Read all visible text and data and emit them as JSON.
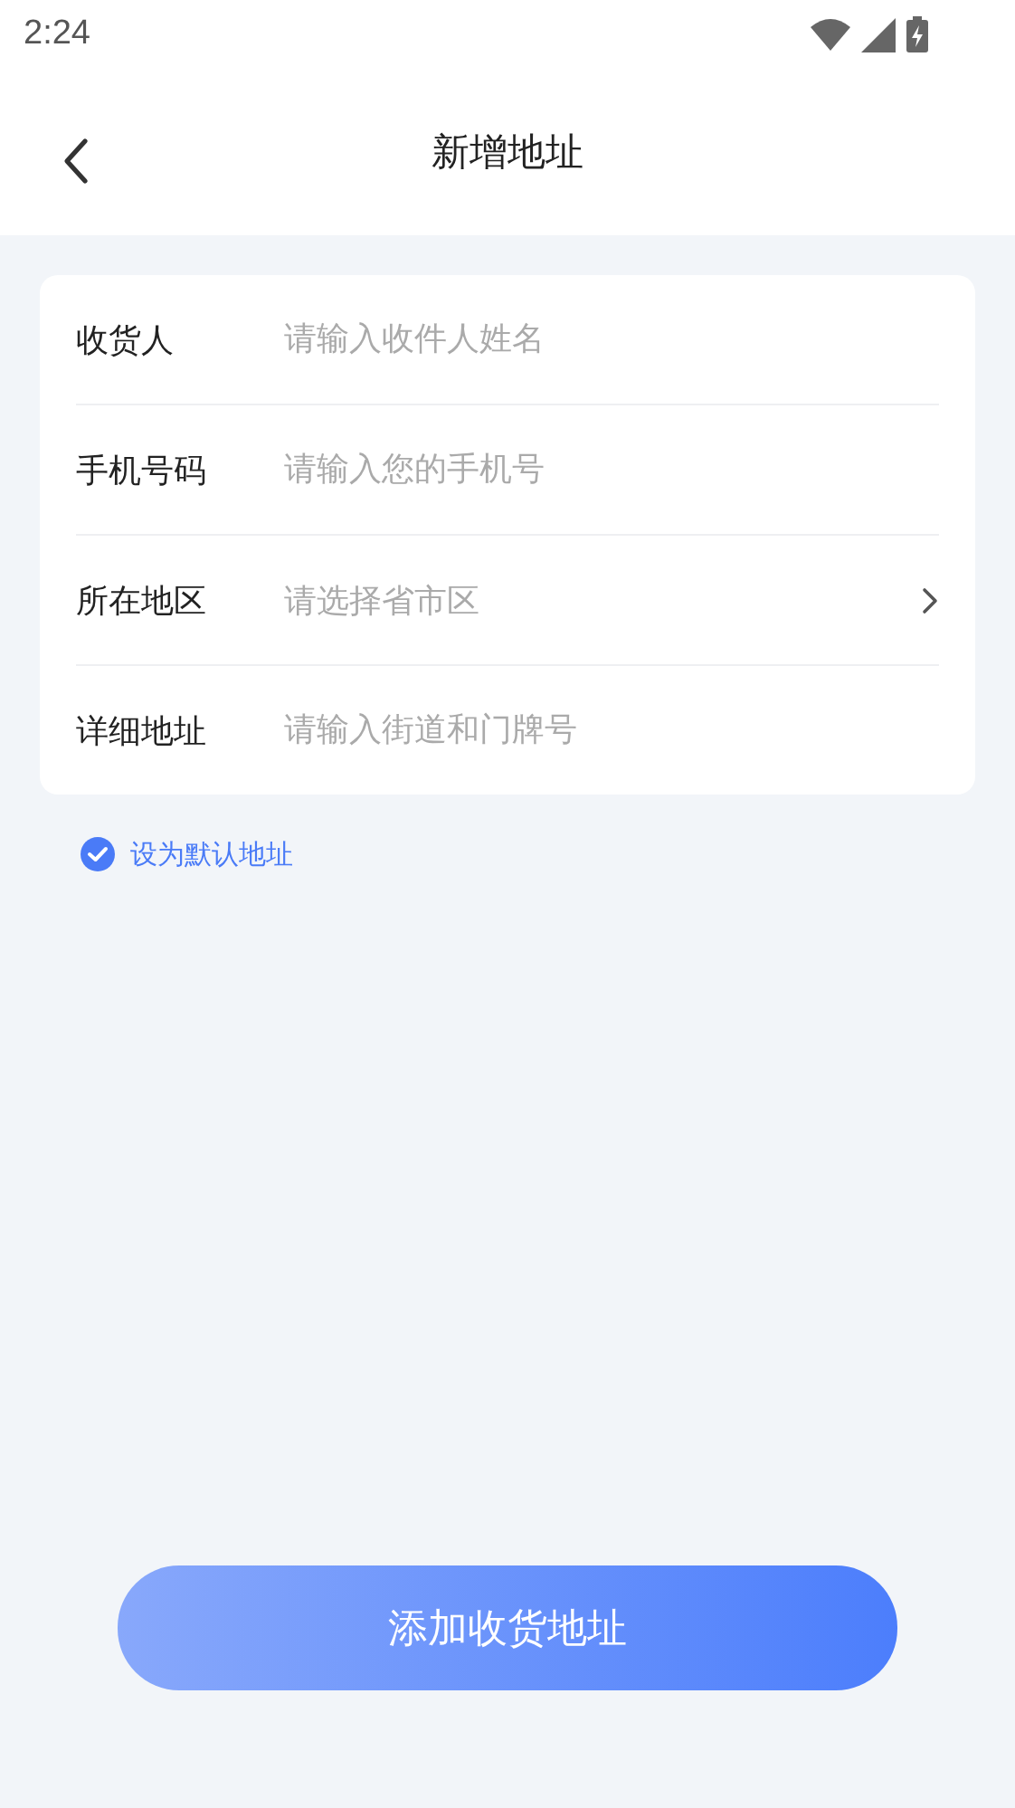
{
  "status_bar": {
    "time": "2:24"
  },
  "nav": {
    "title": "新增地址"
  },
  "fields": [
    {
      "kind": "input",
      "label": "收货人",
      "placeholder": "请输入收件人姓名"
    },
    {
      "kind": "input",
      "label": "手机号码",
      "placeholder": "请输入您的手机号"
    },
    {
      "kind": "select",
      "label": "所在地区",
      "placeholder": "请选择省市区"
    },
    {
      "kind": "input",
      "label": "详细地址",
      "placeholder": "请输入街道和门牌号"
    }
  ],
  "default_option": {
    "label": "设为默认地址",
    "checked": true
  },
  "submit_button": {
    "label": "添加收货地址"
  }
}
